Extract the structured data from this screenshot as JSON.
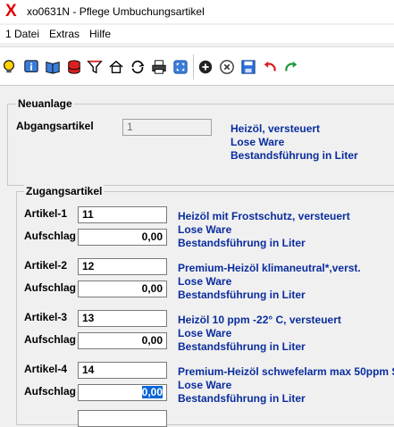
{
  "window": {
    "title": "xo0631N - Pflege Umbuchungsartikel",
    "app_icon": "X"
  },
  "menu": {
    "items": [
      "1 Datei",
      "Extras",
      "Hilfe"
    ]
  },
  "toolbar": {
    "icons": [
      "lightbulb-icon",
      "info-icon",
      "book-icon",
      "database-icon",
      "filter-icon",
      "home-icon",
      "refresh-icon",
      "print-icon",
      "fullscreen-icon",
      "add-icon",
      "delete-icon",
      "save-icon",
      "undo-icon",
      "redo-icon"
    ]
  },
  "neuanlage": {
    "legend": "Neuanlage",
    "abgang_label": "Abgangsartikel",
    "abgang_value": "1",
    "desc": [
      "Heizöl, versteuert",
      "Lose Ware",
      "Bestandsführung in Liter"
    ]
  },
  "zugang": {
    "legend": "Zugangsartikel",
    "items": [
      {
        "label": "Artikel-1",
        "artikel": "11",
        "aufschlag_label": "Aufschlag",
        "aufschlag": "0,00",
        "desc": [
          "Heizöl mit Frostschutz, versteuert",
          "Lose Ware",
          "Bestandsführung in Liter"
        ]
      },
      {
        "label": "Artikel-2",
        "artikel": "12",
        "aufschlag_label": "Aufschlag",
        "aufschlag": "0,00",
        "desc": [
          "Premium-Heizöl klimaneutral*,verst.",
          "Lose Ware",
          "Bestandsführung in Liter"
        ]
      },
      {
        "label": "Artikel-3",
        "artikel": "13",
        "aufschlag_label": "Aufschlag",
        "aufschlag": "0,00",
        "desc": [
          "Heizöl 10 ppm -22° C, versteuert",
          "Lose Ware",
          "Bestandsführung in Liter"
        ]
      },
      {
        "label": "Artikel-4",
        "artikel": "14",
        "aufschlag_label": "Aufschlag",
        "aufschlag": "0,00",
        "desc": [
          "Premium-Heizöl schwefelarm max 50ppm S",
          "Lose Ware",
          "Bestandsführung in Liter"
        ]
      }
    ]
  },
  "colors": {
    "link_blue": "#0a2d9e",
    "brand_red": "#e00000",
    "selection": "#0a66d6"
  }
}
